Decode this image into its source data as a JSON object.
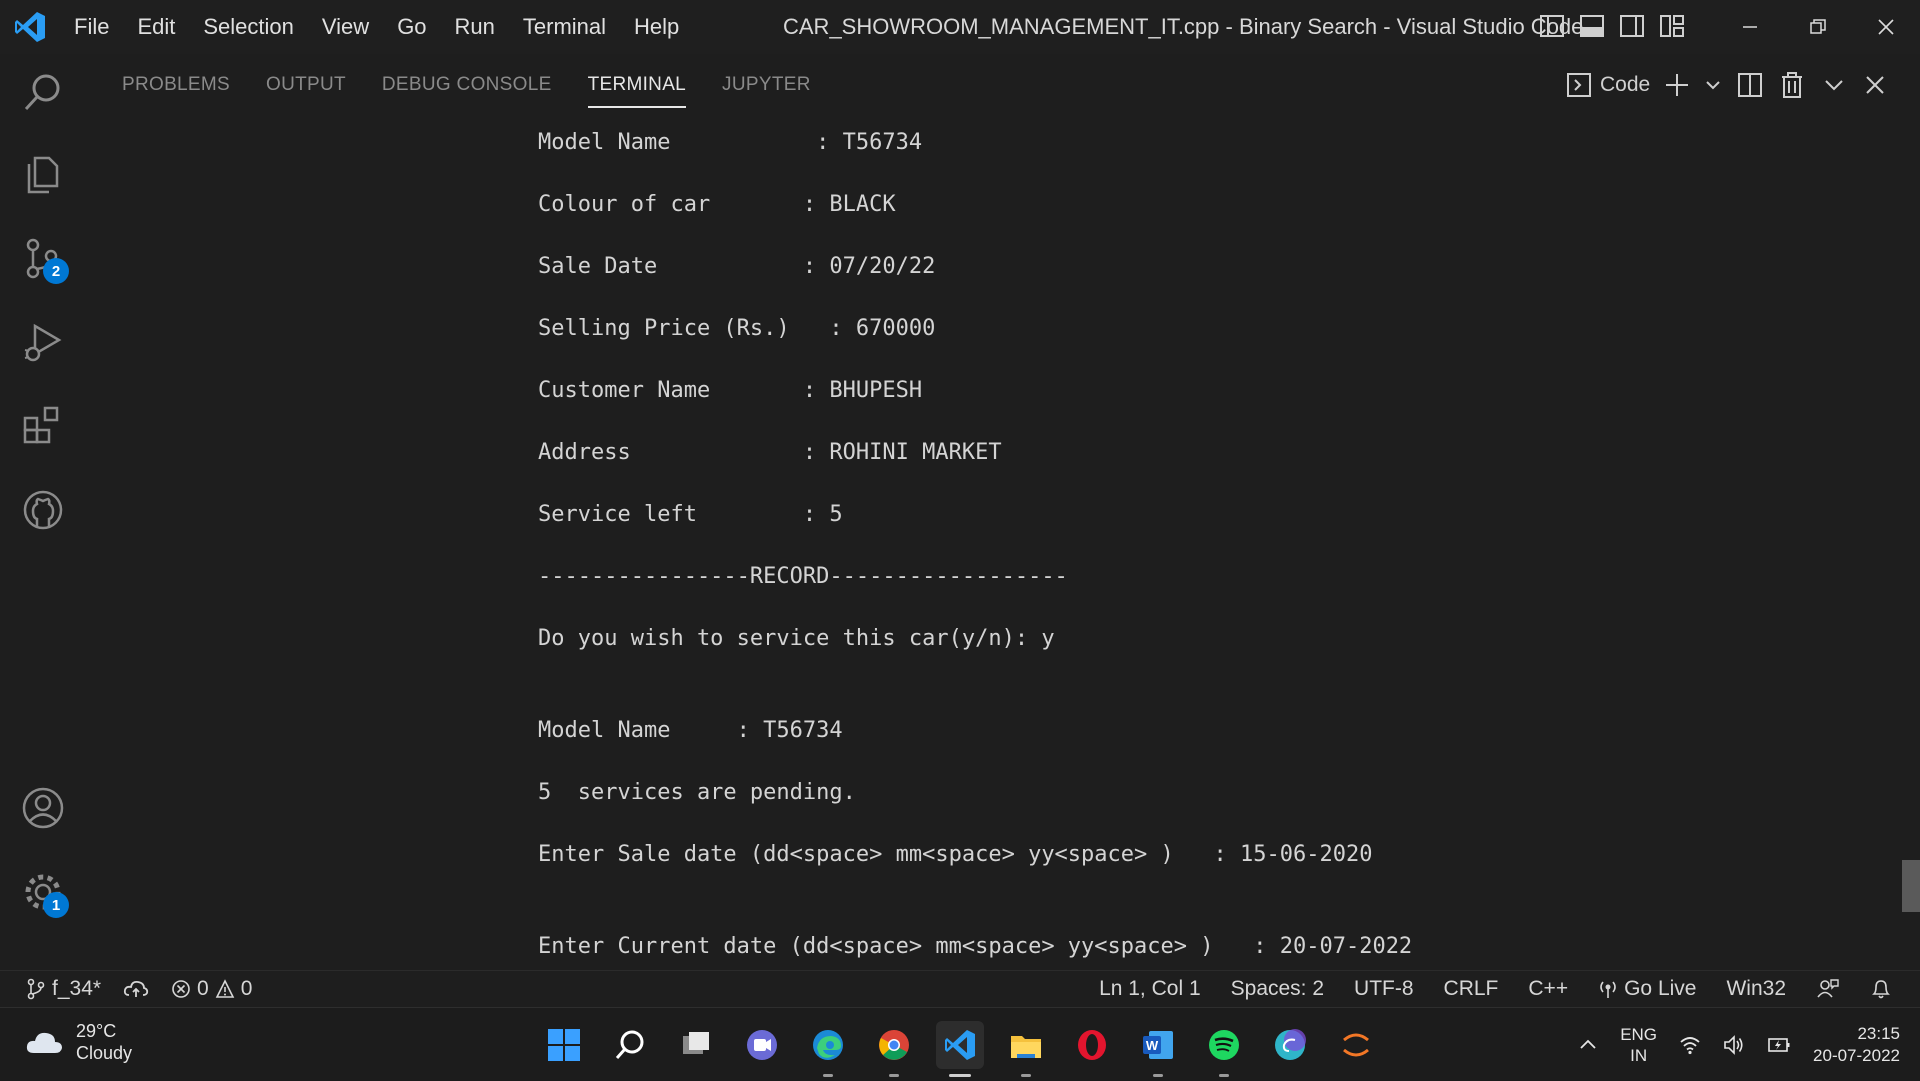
{
  "titlebar": {
    "menu": [
      "File",
      "Edit",
      "Selection",
      "View",
      "Go",
      "Run",
      "Terminal",
      "Help"
    ],
    "title": "CAR_SHOWROOM_MANAGEMENT_IT.cpp - Binary Search - Visual Studio Code"
  },
  "activitybar": {
    "source_control_badge": "2",
    "settings_badge": "1"
  },
  "panel": {
    "tabs": [
      "PROBLEMS",
      "OUTPUT",
      "DEBUG CONSOLE",
      "TERMINAL",
      "JUPYTER"
    ],
    "active_tab": "TERMINAL",
    "terminal_profile": "Code"
  },
  "terminal": {
    "lines": [
      "Model Name           : T56734",
      "Colour of car       : BLACK",
      "Sale Date           : 07/20/22",
      "Selling Price (Rs.)   : 670000",
      "Customer Name       : BHUPESH",
      "Address             : ROHINI MARKET",
      "Service left        : 5",
      "----------------RECORD------------------",
      "Do you wish to service this car(y/n): y",
      "Model Name     : T56734",
      "5  services are pending.",
      "Enter Sale date (dd<space> mm<space> yy<space> )   : 15-06-2020",
      "Enter Current date (dd<space> mm<space> yy<space> )   : 20-07-2022"
    ]
  },
  "statusbar": {
    "branch": "f_34*",
    "errors": "0",
    "warnings": "0",
    "cursor": "Ln 1, Col 1",
    "spaces": "Spaces: 2",
    "encoding": "UTF-8",
    "eol": "CRLF",
    "language": "C++",
    "go_live": "Go Live",
    "platform": "Win32"
  },
  "taskbar": {
    "weather_temp": "29°C",
    "weather_desc": "Cloudy",
    "lang_top": "ENG",
    "lang_bottom": "IN",
    "time": "23:15",
    "date": "20-07-2022"
  },
  "colors": {
    "accent": "#0078d4",
    "background": "#1e1e1e",
    "terminal_text": "#d4d4d4"
  }
}
